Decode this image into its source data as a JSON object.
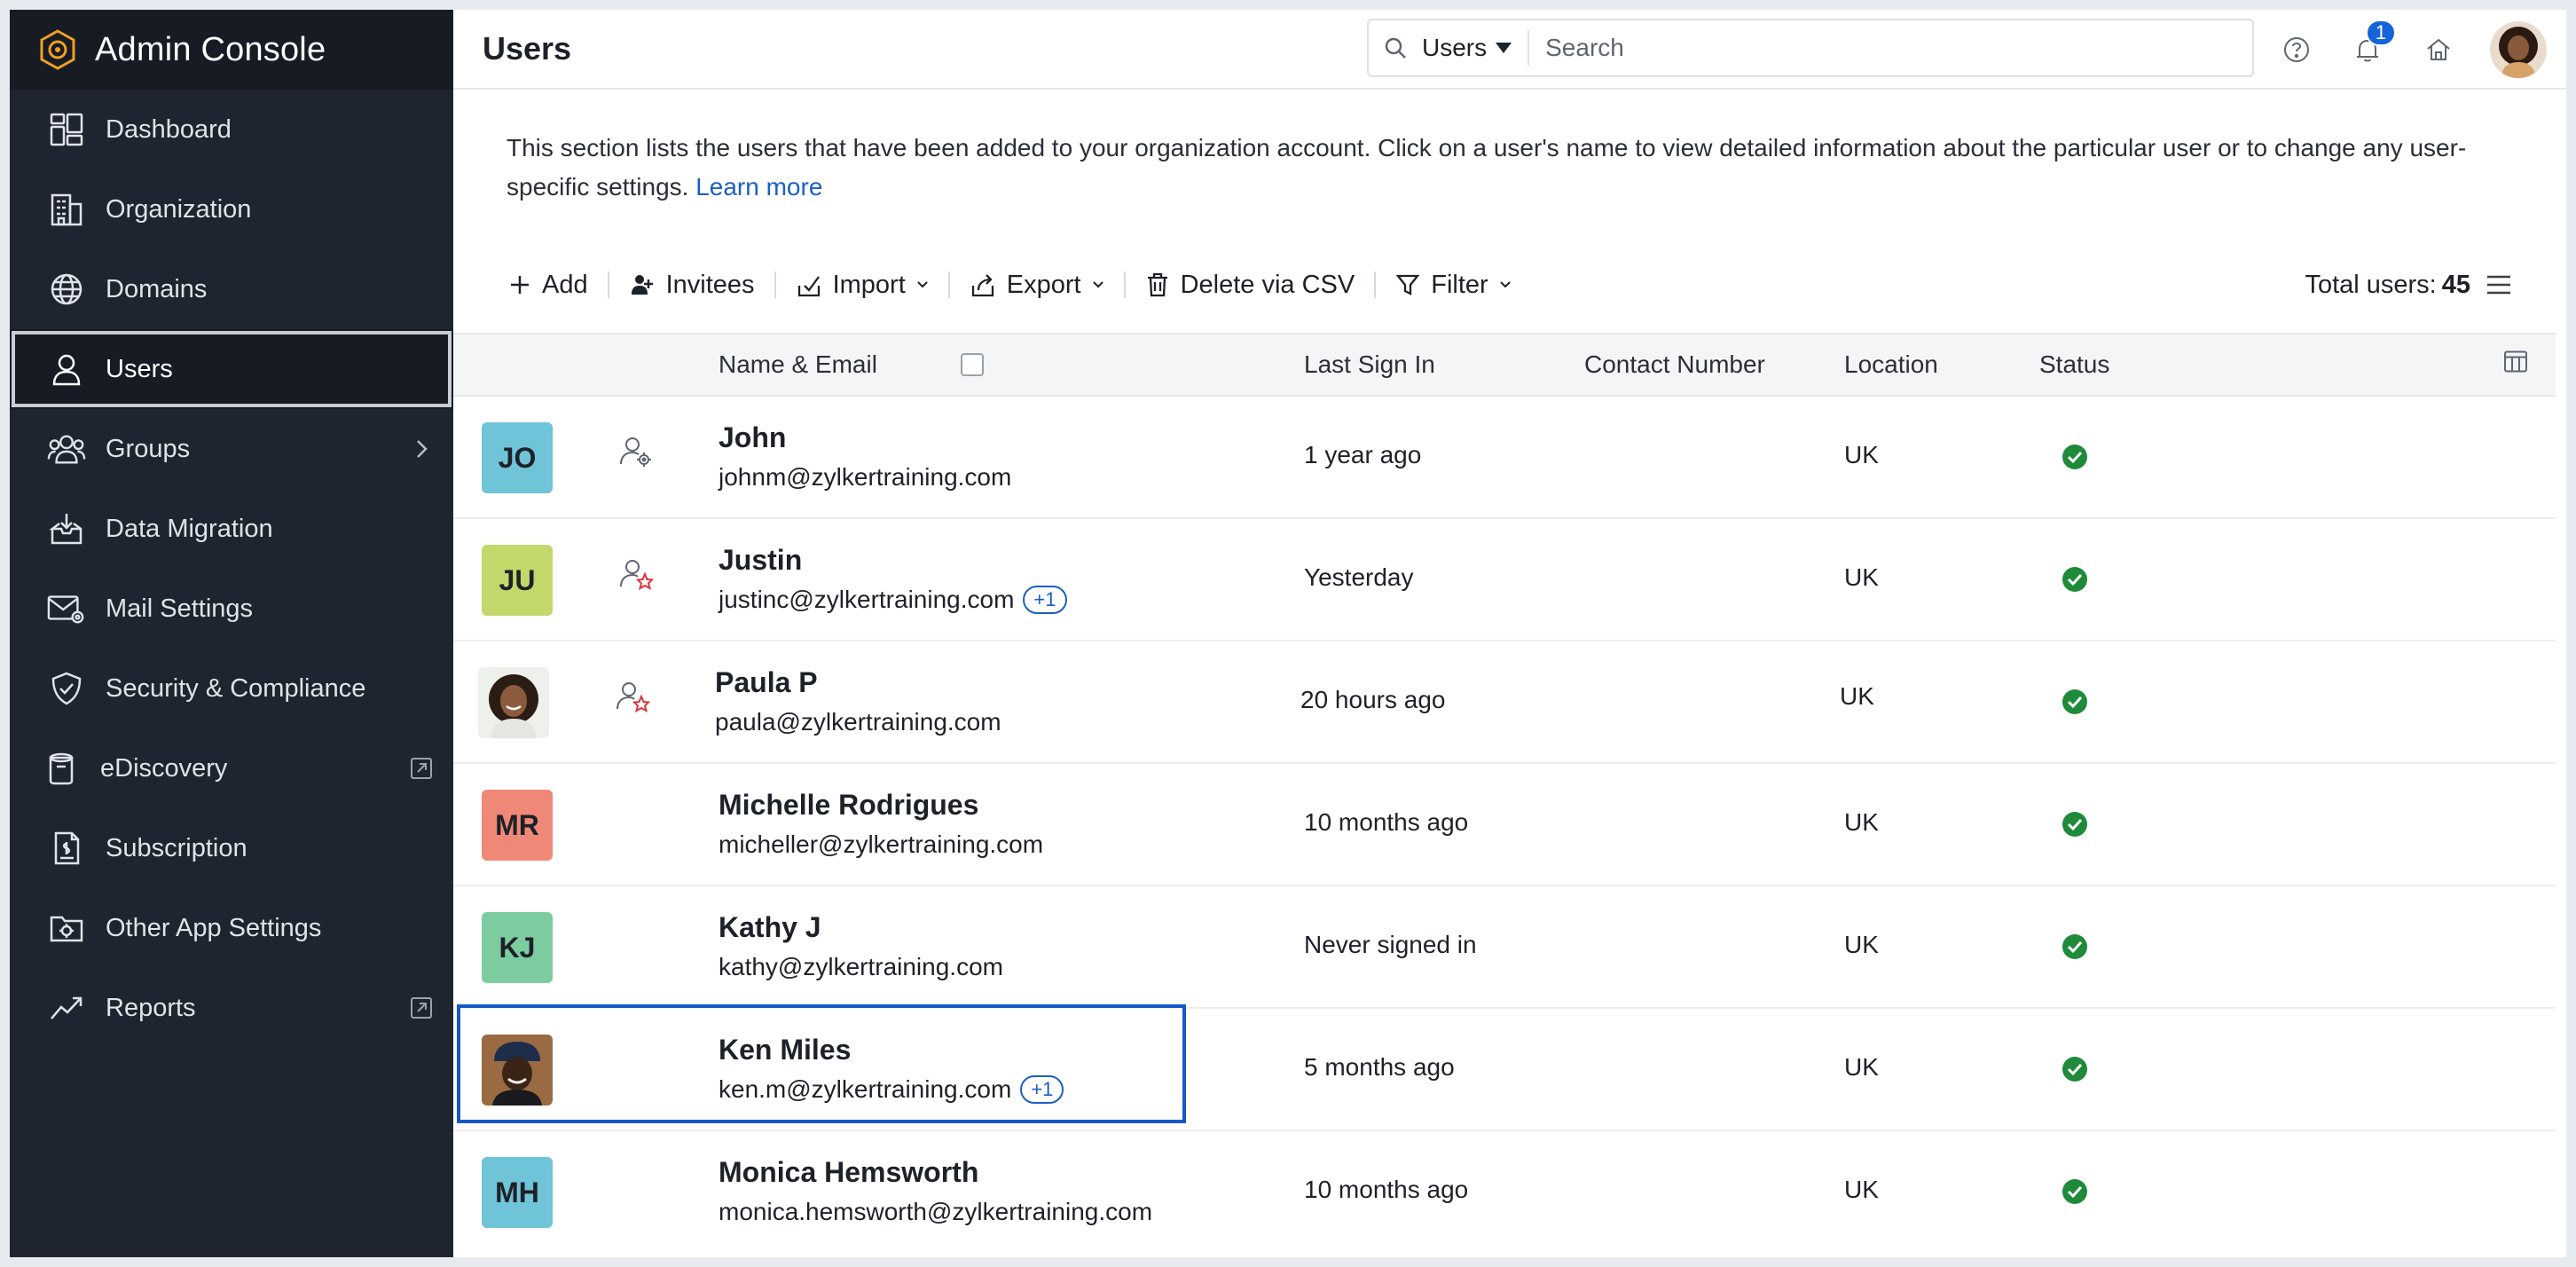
{
  "app": {
    "title": "Admin Console"
  },
  "sidebar": {
    "items": [
      {
        "label": "Dashboard",
        "icon": "dashboard-icon"
      },
      {
        "label": "Organization",
        "icon": "building-icon"
      },
      {
        "label": "Domains",
        "icon": "globe-icon"
      },
      {
        "label": "Users",
        "icon": "user-icon",
        "active": true
      },
      {
        "label": "Groups",
        "icon": "group-icon",
        "trail": "chevron-right-icon"
      },
      {
        "label": "Data Migration",
        "icon": "inbox-import-icon"
      },
      {
        "label": "Mail Settings",
        "icon": "mail-settings-icon"
      },
      {
        "label": "Security & Compliance",
        "icon": "shield-icon"
      },
      {
        "label": "eDiscovery",
        "icon": "archive-icon",
        "trail": "external-link-icon"
      },
      {
        "label": "Subscription",
        "icon": "invoice-icon"
      },
      {
        "label": "Other App Settings",
        "icon": "folder-settings-icon"
      },
      {
        "label": "Reports",
        "icon": "trend-icon",
        "trail": "external-link-icon"
      }
    ]
  },
  "header": {
    "title": "Users",
    "search": {
      "scope": "Users",
      "placeholder": "Search"
    },
    "notifications_count": "1"
  },
  "description": {
    "text": "This section lists the users that have been added to your organization account. Click on a user's name to view detailed information about the particular user or to change any user-specific settings.",
    "link": "Learn more"
  },
  "toolbar": {
    "add": "Add",
    "invitees": "Invitees",
    "import": "Import",
    "export": "Export",
    "delete_csv": "Delete via CSV",
    "filter": "Filter",
    "total_label": "Total users:",
    "total_value": "45"
  },
  "table": {
    "columns": [
      "Name & Email",
      "Last Sign In",
      "Contact Number",
      "Location",
      "Status"
    ],
    "rows": [
      {
        "initials": "JO",
        "avatar_color": "#6fc4d8",
        "role_icon": "user-gear-icon",
        "name": "John",
        "email": "johnm@zylkertraining.com",
        "extra": "",
        "last_sign_in": "1 year ago",
        "contact": "",
        "location": "UK",
        "status": "active"
      },
      {
        "initials": "JU",
        "avatar_color": "#c3d86b",
        "role_icon": "user-star-icon",
        "name": "Justin",
        "email": "justinc@zylkertraining.com",
        "extra": "+1",
        "last_sign_in": "Yesterday",
        "contact": "",
        "location": "UK",
        "status": "active"
      },
      {
        "initials": "",
        "photo": "woman-curly-hair",
        "role_icon": "user-star-icon",
        "name": "Paula P",
        "email": "paula@zylkertraining.com",
        "extra": "",
        "last_sign_in": "20 hours ago",
        "contact": "",
        "location": "UK",
        "status": "active"
      },
      {
        "initials": "MR",
        "avatar_color": "#f08878",
        "role_icon": "",
        "name": "Michelle Rodrigues",
        "email": "micheller@zylkertraining.com",
        "extra": "",
        "last_sign_in": "10 months ago",
        "contact": "",
        "location": "UK",
        "status": "active"
      },
      {
        "initials": "KJ",
        "avatar_color": "#7ccca0",
        "role_icon": "",
        "name": "Kathy J",
        "email": "kathy@zylkertraining.com",
        "extra": "",
        "last_sign_in": "Never signed in",
        "contact": "",
        "location": "UK",
        "status": "active"
      },
      {
        "initials": "",
        "photo": "man-with-cap",
        "role_icon": "",
        "name": "Ken Miles",
        "email": "ken.m@zylkertraining.com",
        "extra": "+1",
        "last_sign_in": "5 months ago",
        "contact": "",
        "location": "UK",
        "status": "active",
        "highlighted": true
      },
      {
        "initials": "MH",
        "avatar_color": "#6fc4d8",
        "role_icon": "",
        "name": "Monica Hemsworth",
        "email": "monica.hemsworth@zylkertraining.com",
        "extra": "",
        "last_sign_in": "10 months ago",
        "contact": "",
        "location": "UK",
        "status": "active"
      }
    ]
  },
  "colors": {
    "sidebar_bg": "#1f2530",
    "accent": "#1a5fc6",
    "status_active": "#1e8a3a",
    "highlight_border": "#1557c8"
  }
}
